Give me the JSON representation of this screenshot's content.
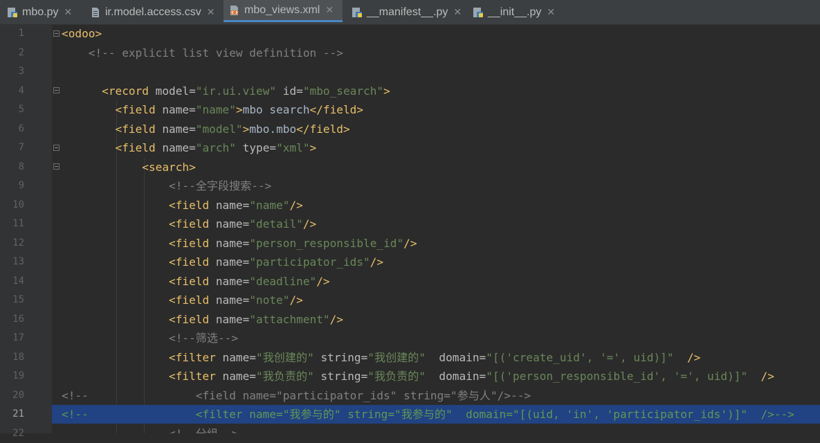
{
  "tabs": [
    {
      "label": "mbo.py",
      "icon": "python-file-icon",
      "active": false
    },
    {
      "label": "ir.model.access.csv",
      "icon": "csv-file-icon",
      "active": false
    },
    {
      "label": "mbo_views.xml",
      "icon": "xml-file-icon",
      "active": true
    },
    {
      "label": "__manifest__.py",
      "icon": "python-file-icon",
      "active": false
    },
    {
      "label": "__init__.py",
      "icon": "python-file-icon",
      "active": false
    }
  ],
  "line_numbers": [
    "1",
    "2",
    "3",
    "4",
    "5",
    "6",
    "7",
    "8",
    "9",
    "10",
    "11",
    "12",
    "13",
    "14",
    "15",
    "16",
    "17",
    "18",
    "19",
    "20",
    "21",
    "22"
  ],
  "current_line": "21",
  "lines": [
    [
      {
        "k": "t",
        "s": "<odoo>"
      }
    ],
    [
      {
        "k": "c",
        "s": "    <!-- explicit list view definition -->"
      }
    ],
    [],
    [
      {
        "k": "p",
        "s": "      "
      },
      {
        "k": "t",
        "s": "<record"
      },
      {
        "k": "a",
        "s": " model="
      },
      {
        "k": "v",
        "s": "\"ir.ui.view\""
      },
      {
        "k": "a",
        "s": " id="
      },
      {
        "k": "v",
        "s": "\"mbo_search\""
      },
      {
        "k": "t",
        "s": ">"
      }
    ],
    [
      {
        "k": "p",
        "s": "        "
      },
      {
        "k": "t",
        "s": "<field"
      },
      {
        "k": "a",
        "s": " name="
      },
      {
        "k": "v",
        "s": "\"name\""
      },
      {
        "k": "t",
        "s": ">"
      },
      {
        "k": "p",
        "s": "mbo search"
      },
      {
        "k": "t",
        "s": "</field>"
      }
    ],
    [
      {
        "k": "p",
        "s": "        "
      },
      {
        "k": "t",
        "s": "<field"
      },
      {
        "k": "a",
        "s": " name="
      },
      {
        "k": "v",
        "s": "\"model\""
      },
      {
        "k": "t",
        "s": ">"
      },
      {
        "k": "p",
        "s": "mbo.mbo"
      },
      {
        "k": "t",
        "s": "</field>"
      }
    ],
    [
      {
        "k": "p",
        "s": "        "
      },
      {
        "k": "t",
        "s": "<field"
      },
      {
        "k": "a",
        "s": " name="
      },
      {
        "k": "v",
        "s": "\"arch\""
      },
      {
        "k": "a",
        "s": " type="
      },
      {
        "k": "v",
        "s": "\"xml\""
      },
      {
        "k": "t",
        "s": ">"
      }
    ],
    [
      {
        "k": "p",
        "s": "            "
      },
      {
        "k": "t",
        "s": "<search>"
      }
    ],
    [
      {
        "k": "c",
        "s": "                <!--全字段搜索-->"
      }
    ],
    [
      {
        "k": "p",
        "s": "                "
      },
      {
        "k": "t",
        "s": "<field"
      },
      {
        "k": "a",
        "s": " name="
      },
      {
        "k": "v",
        "s": "\"name\""
      },
      {
        "k": "t",
        "s": "/>"
      }
    ],
    [
      {
        "k": "p",
        "s": "                "
      },
      {
        "k": "t",
        "s": "<field"
      },
      {
        "k": "a",
        "s": " name="
      },
      {
        "k": "v",
        "s": "\"detail\""
      },
      {
        "k": "t",
        "s": "/>"
      }
    ],
    [
      {
        "k": "p",
        "s": "                "
      },
      {
        "k": "t",
        "s": "<field"
      },
      {
        "k": "a",
        "s": " name="
      },
      {
        "k": "v",
        "s": "\"person_responsible_id\""
      },
      {
        "k": "t",
        "s": "/>"
      }
    ],
    [
      {
        "k": "p",
        "s": "                "
      },
      {
        "k": "t",
        "s": "<field"
      },
      {
        "k": "a",
        "s": " name="
      },
      {
        "k": "v",
        "s": "\"participator_ids\""
      },
      {
        "k": "t",
        "s": "/>"
      }
    ],
    [
      {
        "k": "p",
        "s": "                "
      },
      {
        "k": "t",
        "s": "<field"
      },
      {
        "k": "a",
        "s": " name="
      },
      {
        "k": "v",
        "s": "\"deadline\""
      },
      {
        "k": "t",
        "s": "/>"
      }
    ],
    [
      {
        "k": "p",
        "s": "                "
      },
      {
        "k": "t",
        "s": "<field"
      },
      {
        "k": "a",
        "s": " name="
      },
      {
        "k": "v",
        "s": "\"note\""
      },
      {
        "k": "t",
        "s": "/>"
      }
    ],
    [
      {
        "k": "p",
        "s": "                "
      },
      {
        "k": "t",
        "s": "<field"
      },
      {
        "k": "a",
        "s": " name="
      },
      {
        "k": "v",
        "s": "\"attachment\""
      },
      {
        "k": "t",
        "s": "/>"
      }
    ],
    [
      {
        "k": "c",
        "s": "                <!--筛选-->"
      }
    ],
    [
      {
        "k": "p",
        "s": "                "
      },
      {
        "k": "t",
        "s": "<filter"
      },
      {
        "k": "a",
        "s": " name="
      },
      {
        "k": "v",
        "s": "\"我创建的\""
      },
      {
        "k": "a",
        "s": " string="
      },
      {
        "k": "v",
        "s": "\"我创建的\""
      },
      {
        "k": "a",
        "s": "  domain="
      },
      {
        "k": "v",
        "s": "\"[('create_uid', '=', uid)]\""
      },
      {
        "k": "t",
        "s": "  />"
      }
    ],
    [
      {
        "k": "p",
        "s": "                "
      },
      {
        "k": "t",
        "s": "<filter"
      },
      {
        "k": "a",
        "s": " name="
      },
      {
        "k": "v",
        "s": "\"我负责的\""
      },
      {
        "k": "a",
        "s": " string="
      },
      {
        "k": "v",
        "s": "\"我负责的\""
      },
      {
        "k": "a",
        "s": "  domain="
      },
      {
        "k": "v",
        "s": "\"[('person_responsible_id', '=', uid)]\""
      },
      {
        "k": "t",
        "s": "  />"
      }
    ],
    [
      {
        "k": "c",
        "s": "<!--                <field name=\"participator_ids\" string=\"参与人\"/>-->"
      }
    ],
    [
      {
        "k": "cs",
        "s": "<!--                <filter name=\"我参与的\" string=\"我参与的\"  domain=\"[(uid, 'in', 'participator_ids')]\"  />-->"
      }
    ],
    [
      {
        "k": "c",
        "s": "                <!--分组-->"
      }
    ]
  ],
  "colors": {
    "background": "#2b2b2b",
    "tag": "#e8bf6a",
    "attribute": "#bababa",
    "string": "#6a8759",
    "comment": "#808080",
    "selection": "#214283"
  }
}
